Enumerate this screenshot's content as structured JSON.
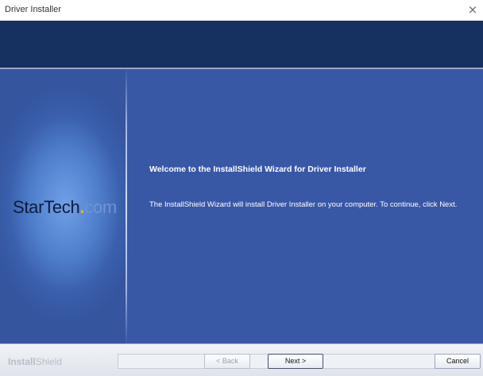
{
  "window": {
    "title": "Driver Installer",
    "close_glyph": "×"
  },
  "logo": {
    "brand": "StarTech",
    "dot": ".",
    "tld": "com"
  },
  "content": {
    "welcome": "Welcome to the InstallShield Wizard for Driver Installer",
    "body": "The InstallShield Wizard will install Driver Installer on your computer.  To continue, click Next."
  },
  "footer": {
    "brand_left": "Install",
    "brand_right": "Shield"
  },
  "buttons": {
    "back": "< Back",
    "next": "Next >",
    "cancel": "Cancel"
  },
  "colors": {
    "header": "#16305f",
    "panel": "#3858a6",
    "text": "#ffffff"
  }
}
